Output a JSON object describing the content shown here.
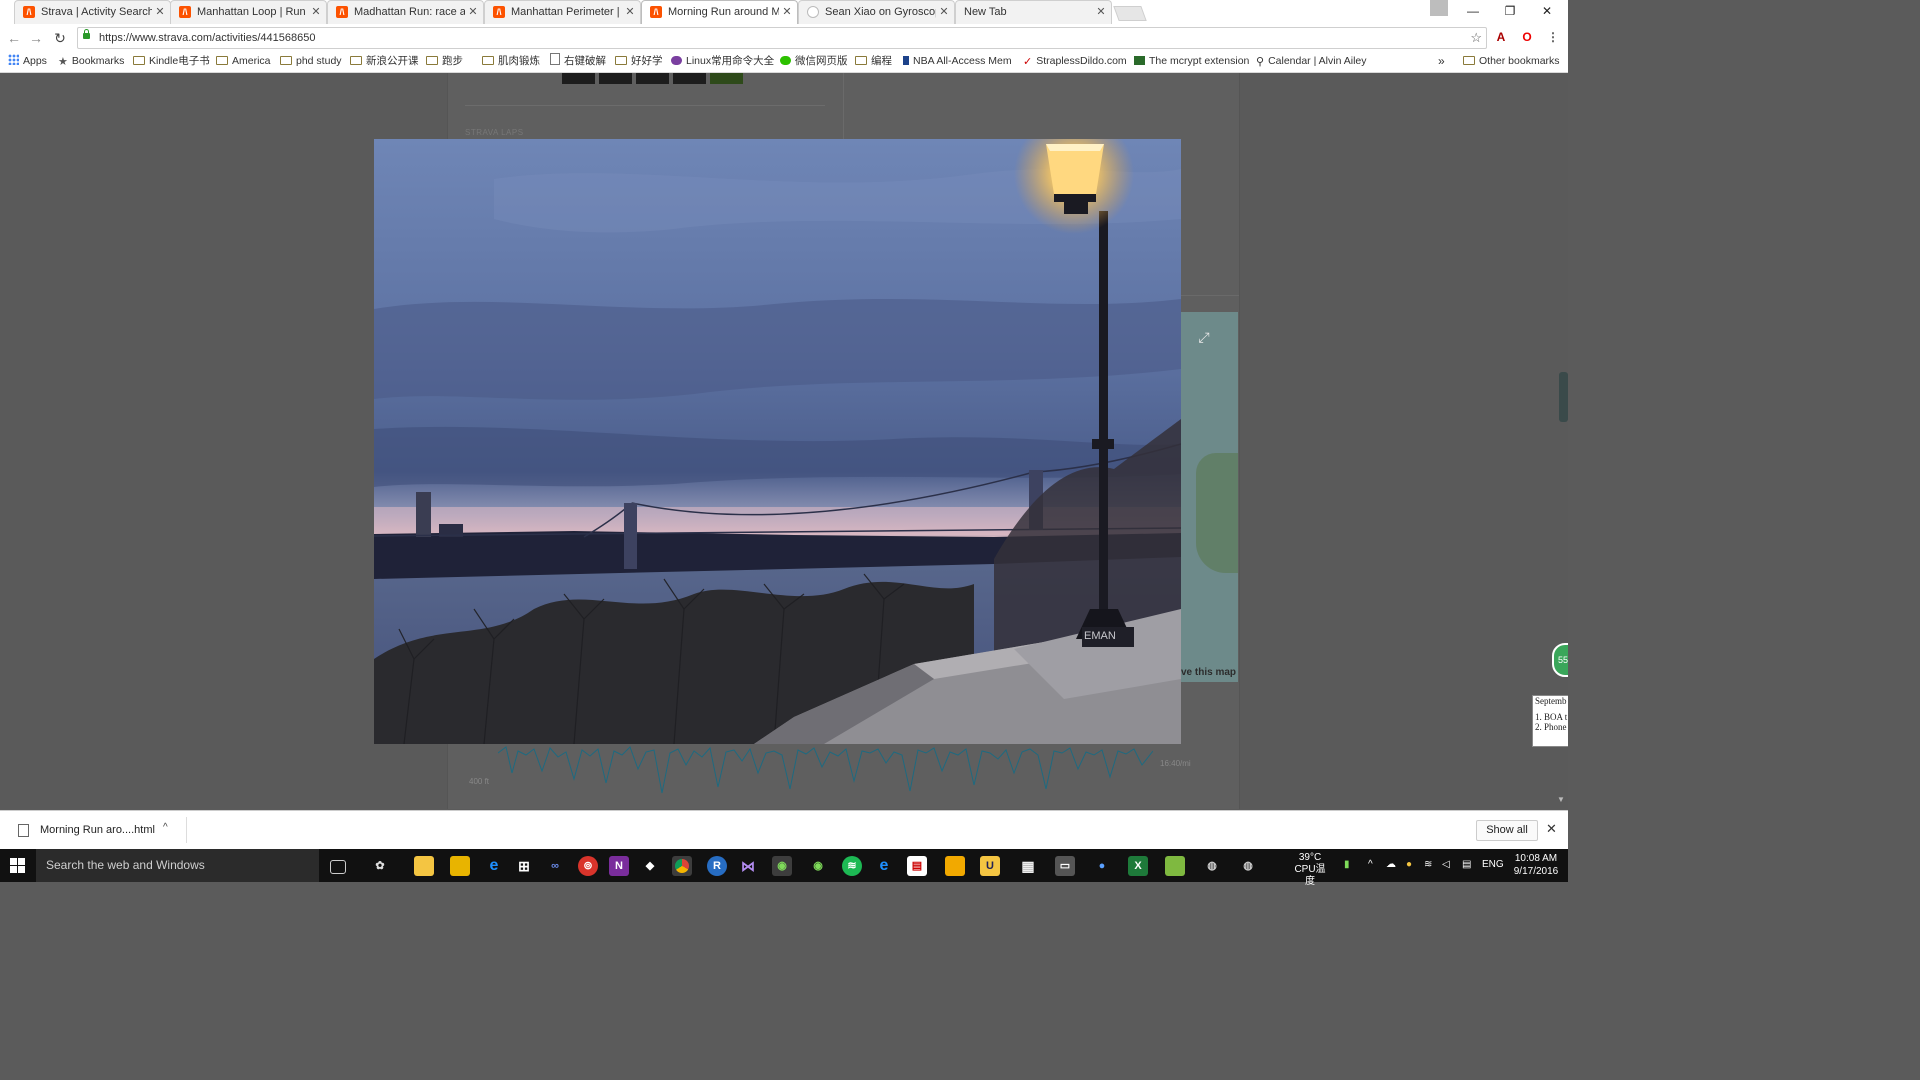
{
  "browser": {
    "tabs": [
      {
        "title": "Strava | Activity Search",
        "favicon": "strava"
      },
      {
        "title": "Manhattan Loop | Run | S",
        "favicon": "strava"
      },
      {
        "title": "Madhattan Run: race aro",
        "favicon": "strava"
      },
      {
        "title": "Manhattan Perimeter | R",
        "favicon": "strava"
      },
      {
        "title": "Morning Run around Ma",
        "favicon": "strava"
      },
      {
        "title": "Sean Xiao on Gyroscope",
        "favicon": "generic"
      },
      {
        "title": "New Tab",
        "favicon": "none"
      }
    ],
    "active_tab": 4,
    "url": "https://www.strava.com/activities/441568650",
    "bookmarks": [
      {
        "label": "Apps",
        "icon": "apps-icon"
      },
      {
        "label": "Bookmarks",
        "icon": "star-icon"
      },
      {
        "label": "Kindle电子书",
        "icon": "folder-icon"
      },
      {
        "label": "America",
        "icon": "folder-icon"
      },
      {
        "label": "phd study",
        "icon": "folder-icon"
      },
      {
        "label": "新浪公开课",
        "icon": "folder-icon"
      },
      {
        "label": "跑步",
        "icon": "folder-icon"
      },
      {
        "label": "肌肉锻炼",
        "icon": "folder-icon"
      },
      {
        "label": "右键破解",
        "icon": "page-icon"
      },
      {
        "label": "好好学",
        "icon": "folder-icon"
      },
      {
        "label": "Linux常用命令大全",
        "icon": "linux-icon"
      },
      {
        "label": "微信网页版",
        "icon": "wechat-icon"
      },
      {
        "label": "编程",
        "icon": "folder-icon"
      },
      {
        "label": "NBA All-Access Mem",
        "icon": "nba-icon"
      },
      {
        "label": "StraplessDildo.com",
        "icon": "link-icon"
      },
      {
        "label": "The mcrypt extension",
        "icon": "cg-icon"
      },
      {
        "label": "Calendar | Alvin Ailey",
        "icon": "dancer-icon"
      }
    ],
    "bookmarks_overflow": "»",
    "other_bookmarks": "Other bookmarks"
  },
  "page": {
    "laps_heading": "STRAVA LAPS",
    "save_map": "ve this map",
    "chart_y_label": "400 ft",
    "chart_x_label": "16:40/mi",
    "side_badge": "55",
    "notepad_lines": [
      "Septemb",
      "1. BOA t",
      "2. Phone"
    ]
  },
  "lightbox": {
    "photo_caption_engraving": "EMAN"
  },
  "downloads": {
    "file_name": "Morning Run aro....html",
    "show_all": "Show all"
  },
  "taskbar": {
    "search_placeholder": "Search the web and Windows",
    "temperature": "39°C",
    "cpu_label": "CPU温度",
    "language": "ENG",
    "time": "10:08 AM",
    "date": "9/17/2016"
  },
  "colors": {
    "strava_orange": "#fc5200",
    "taskbar": "#111111",
    "overlay_backdrop": "#5a5a5a"
  }
}
